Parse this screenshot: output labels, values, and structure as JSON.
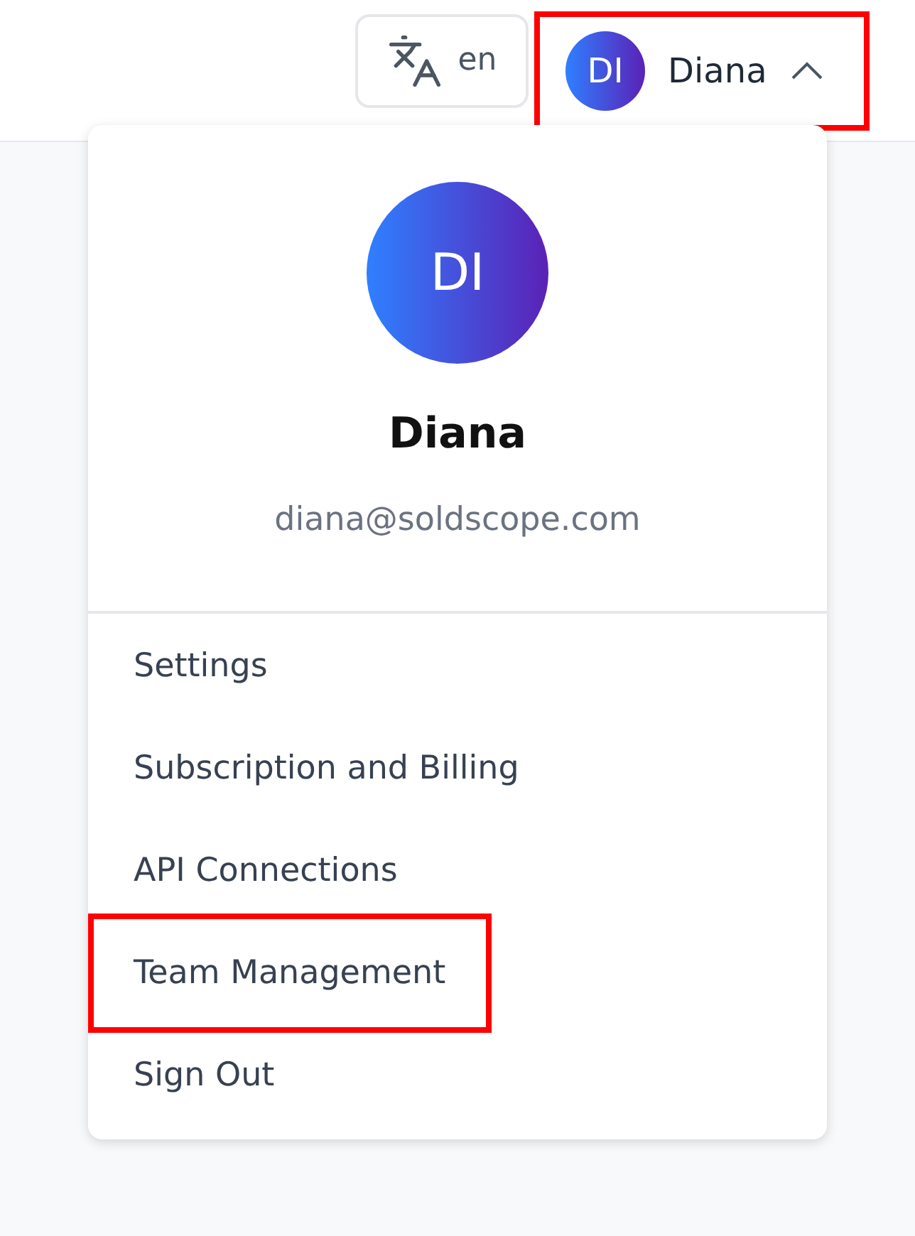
{
  "language_button": {
    "label": "en"
  },
  "user_button": {
    "initials": "DI",
    "name": "Diana",
    "expanded": true,
    "highlighted": true
  },
  "dropdown": {
    "initials": "DI",
    "name": "Diana",
    "email": "diana@soldscope.com",
    "items": [
      {
        "label": "Settings",
        "highlighted": false
      },
      {
        "label": "Subscription and Billing",
        "highlighted": false
      },
      {
        "label": "API Connections",
        "highlighted": false
      },
      {
        "label": "Team Management",
        "highlighted": true
      },
      {
        "label": "Sign Out",
        "highlighted": false
      }
    ]
  }
}
